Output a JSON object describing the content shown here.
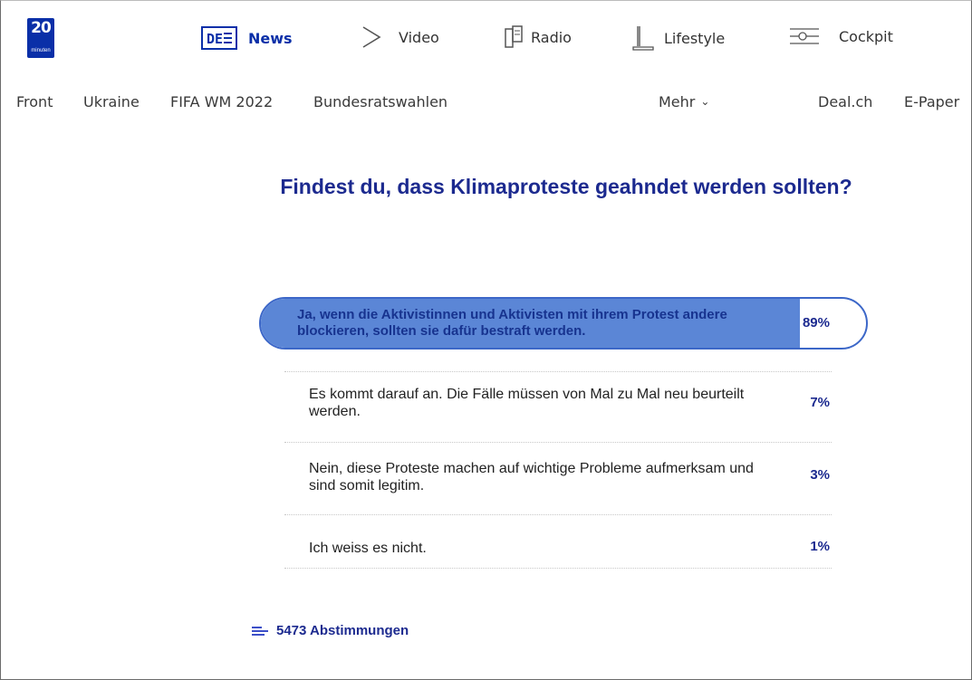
{
  "header": {
    "logo": {
      "number": "20",
      "word": "minuten"
    },
    "nav": [
      {
        "label": "News",
        "icon": "news-icon",
        "active": true
      },
      {
        "label": "Video",
        "icon": "play-icon"
      },
      {
        "label": "Radio",
        "icon": "radio-icon"
      },
      {
        "label": "Lifestyle",
        "icon": "lifestyle-icon"
      },
      {
        "label": "Cockpit",
        "icon": "sliders-icon"
      }
    ]
  },
  "sections": {
    "front": "Front",
    "ukraine": "Ukraine",
    "fifa": "FIFA WM 2022",
    "bundesrat": "Bundesratswahlen",
    "mehr": "Mehr",
    "deal": "Deal.ch",
    "epaper": "E-Paper"
  },
  "poll": {
    "question": "Findest du, dass Klimaproteste geahndet werden sollten?",
    "options": [
      {
        "text": "Ja, wenn die Aktivistinnen und Aktivisten mit ihrem Protest andere blockieren, sollten sie dafür bestraft werden.",
        "percent_label": "89%",
        "percent": 89,
        "selected": true
      },
      {
        "text": "Es kommt darauf an. Die Fälle müssen von Mal zu Mal neu beurteilt werden.",
        "percent_label": "7%",
        "percent": 7
      },
      {
        "text": "Nein, diese Proteste machen auf wichtige Probleme aufmerksam und sind somit legitim.",
        "percent_label": "3%",
        "percent": 3
      },
      {
        "text": "Ich weiss es nicht.",
        "percent_label": "1%",
        "percent": 1
      }
    ],
    "total_votes": "5473 Abstimmungen"
  },
  "colors": {
    "brand": "#0a2fa8",
    "question": "#1c2a8f",
    "bar_fill": "#5b86d6",
    "bar_border": "#3c67c8"
  }
}
